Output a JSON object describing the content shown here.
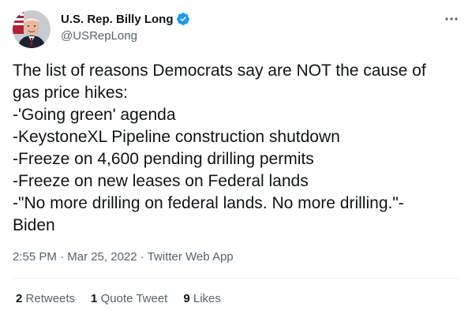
{
  "author": {
    "display_name": "U.S. Rep. Billy Long",
    "handle": "@USRepLong",
    "verified_color": "#1d9bf0"
  },
  "tweet": {
    "lines": [
      "The list of reasons Democrats say are NOT the cause of",
      "gas price hikes:",
      "-'Going green' agenda",
      "-KeystoneXL Pipeline construction shutdown",
      "-Freeze on 4,600 pending drilling permits",
      "-Freeze on new leases on Federal lands",
      "-\"No more drilling on federal lands. No more drilling.\"-",
      "Biden"
    ]
  },
  "meta": {
    "time": "2:55 PM",
    "separator": "·",
    "date": "Mar 25, 2022",
    "source": "Twitter Web App"
  },
  "stats": {
    "retweets_count": "2",
    "retweets_label": "Retweets",
    "quotes_count": "1",
    "quotes_label": "Quote Tweet",
    "likes_count": "9",
    "likes_label": "Likes"
  },
  "icons": {
    "more": "more-icon",
    "verified": "verified-badge-icon"
  }
}
